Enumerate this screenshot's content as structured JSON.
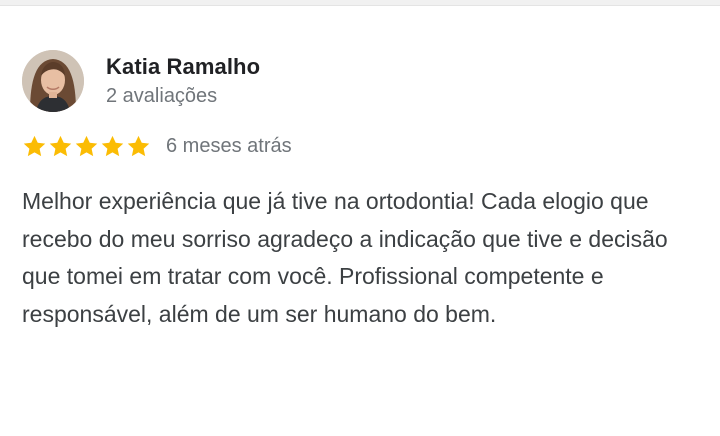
{
  "review": {
    "author": {
      "name": "Katia Ramalho",
      "review_count": "2 avaliações",
      "avatar_icon": "profile-photo"
    },
    "rating": {
      "stars": 5,
      "max_stars": 5,
      "star_icon": "star-icon",
      "star_color": "#fbbc04"
    },
    "date": "6 meses atrás",
    "text": "Melhor experiência que já tive na ortodontia! Cada elogio que recebo do meu sorriso agradeço a indicação que tive e decisão que tomei em tratar com você. Profissional competente e responsável, além de um ser humano do bem."
  },
  "colors": {
    "name": "#202124",
    "secondary": "#70757a",
    "body": "#3c4043"
  }
}
